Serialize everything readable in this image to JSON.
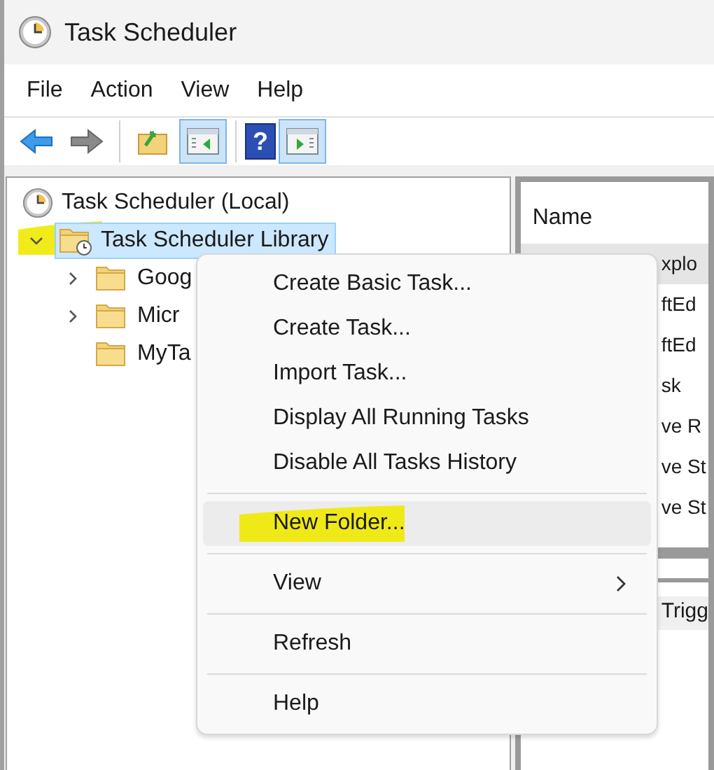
{
  "window": {
    "title": "Task Scheduler"
  },
  "menu_bar": [
    "File",
    "Action",
    "View",
    "Help"
  ],
  "toolbar": [
    {
      "kind": "back",
      "pressed": false
    },
    {
      "kind": "forward",
      "pressed": false
    },
    {
      "kind": "separator"
    },
    {
      "kind": "up",
      "pressed": false
    },
    {
      "kind": "console-tree",
      "pressed": true
    },
    {
      "kind": "separator"
    },
    {
      "kind": "help",
      "label": "?",
      "pressed": false
    },
    {
      "kind": "action-pane",
      "pressed": true
    }
  ],
  "tree": [
    {
      "label": "Task Scheduler (Local)",
      "kind": "root",
      "selected": false,
      "children": [
        {
          "label": "Task Scheduler Library",
          "kind": "library",
          "selected": true,
          "expanded": true,
          "highlighted": true,
          "children": [
            {
              "label": "Goog",
              "kind": "folder",
              "selected": false,
              "has_children": true
            },
            {
              "label": "Micr",
              "kind": "folder",
              "selected": false,
              "has_children": true
            },
            {
              "label": "MyTa",
              "kind": "folder",
              "selected": false,
              "has_children": false
            }
          ]
        }
      ]
    }
  ],
  "list": {
    "column": "Name",
    "rows": [
      {
        "text": "xplo",
        "selected": true
      },
      {
        "text": "ftEd",
        "selected": false
      },
      {
        "text": "ftEd",
        "selected": false
      },
      {
        "text": "sk",
        "selected": false
      },
      {
        "text": "ve R",
        "selected": false
      },
      {
        "text": "ve St",
        "selected": false
      },
      {
        "text": "ve St",
        "selected": false
      }
    ]
  },
  "lower_tab": "Trigg",
  "context_menu": [
    {
      "kind": "item",
      "label": "Create Basic Task...",
      "hovered": false,
      "highlighted": false
    },
    {
      "kind": "item",
      "label": "Create Task...",
      "hovered": false,
      "highlighted": false
    },
    {
      "kind": "item",
      "label": "Import Task...",
      "hovered": false,
      "highlighted": false
    },
    {
      "kind": "item",
      "label": "Display All Running Tasks",
      "hovered": false,
      "highlighted": false
    },
    {
      "kind": "item",
      "label": "Disable All Tasks History",
      "hovered": false,
      "highlighted": false
    },
    {
      "kind": "separator"
    },
    {
      "kind": "item",
      "label": "New Folder...",
      "hovered": true,
      "highlighted": true
    },
    {
      "kind": "separator"
    },
    {
      "kind": "submenu",
      "label": "View",
      "hovered": false,
      "highlighted": false
    },
    {
      "kind": "separator"
    },
    {
      "kind": "item",
      "label": "Refresh",
      "hovered": false,
      "highlighted": false
    },
    {
      "kind": "separator"
    },
    {
      "kind": "item",
      "label": "Help",
      "hovered": false,
      "highlighted": false
    }
  ]
}
